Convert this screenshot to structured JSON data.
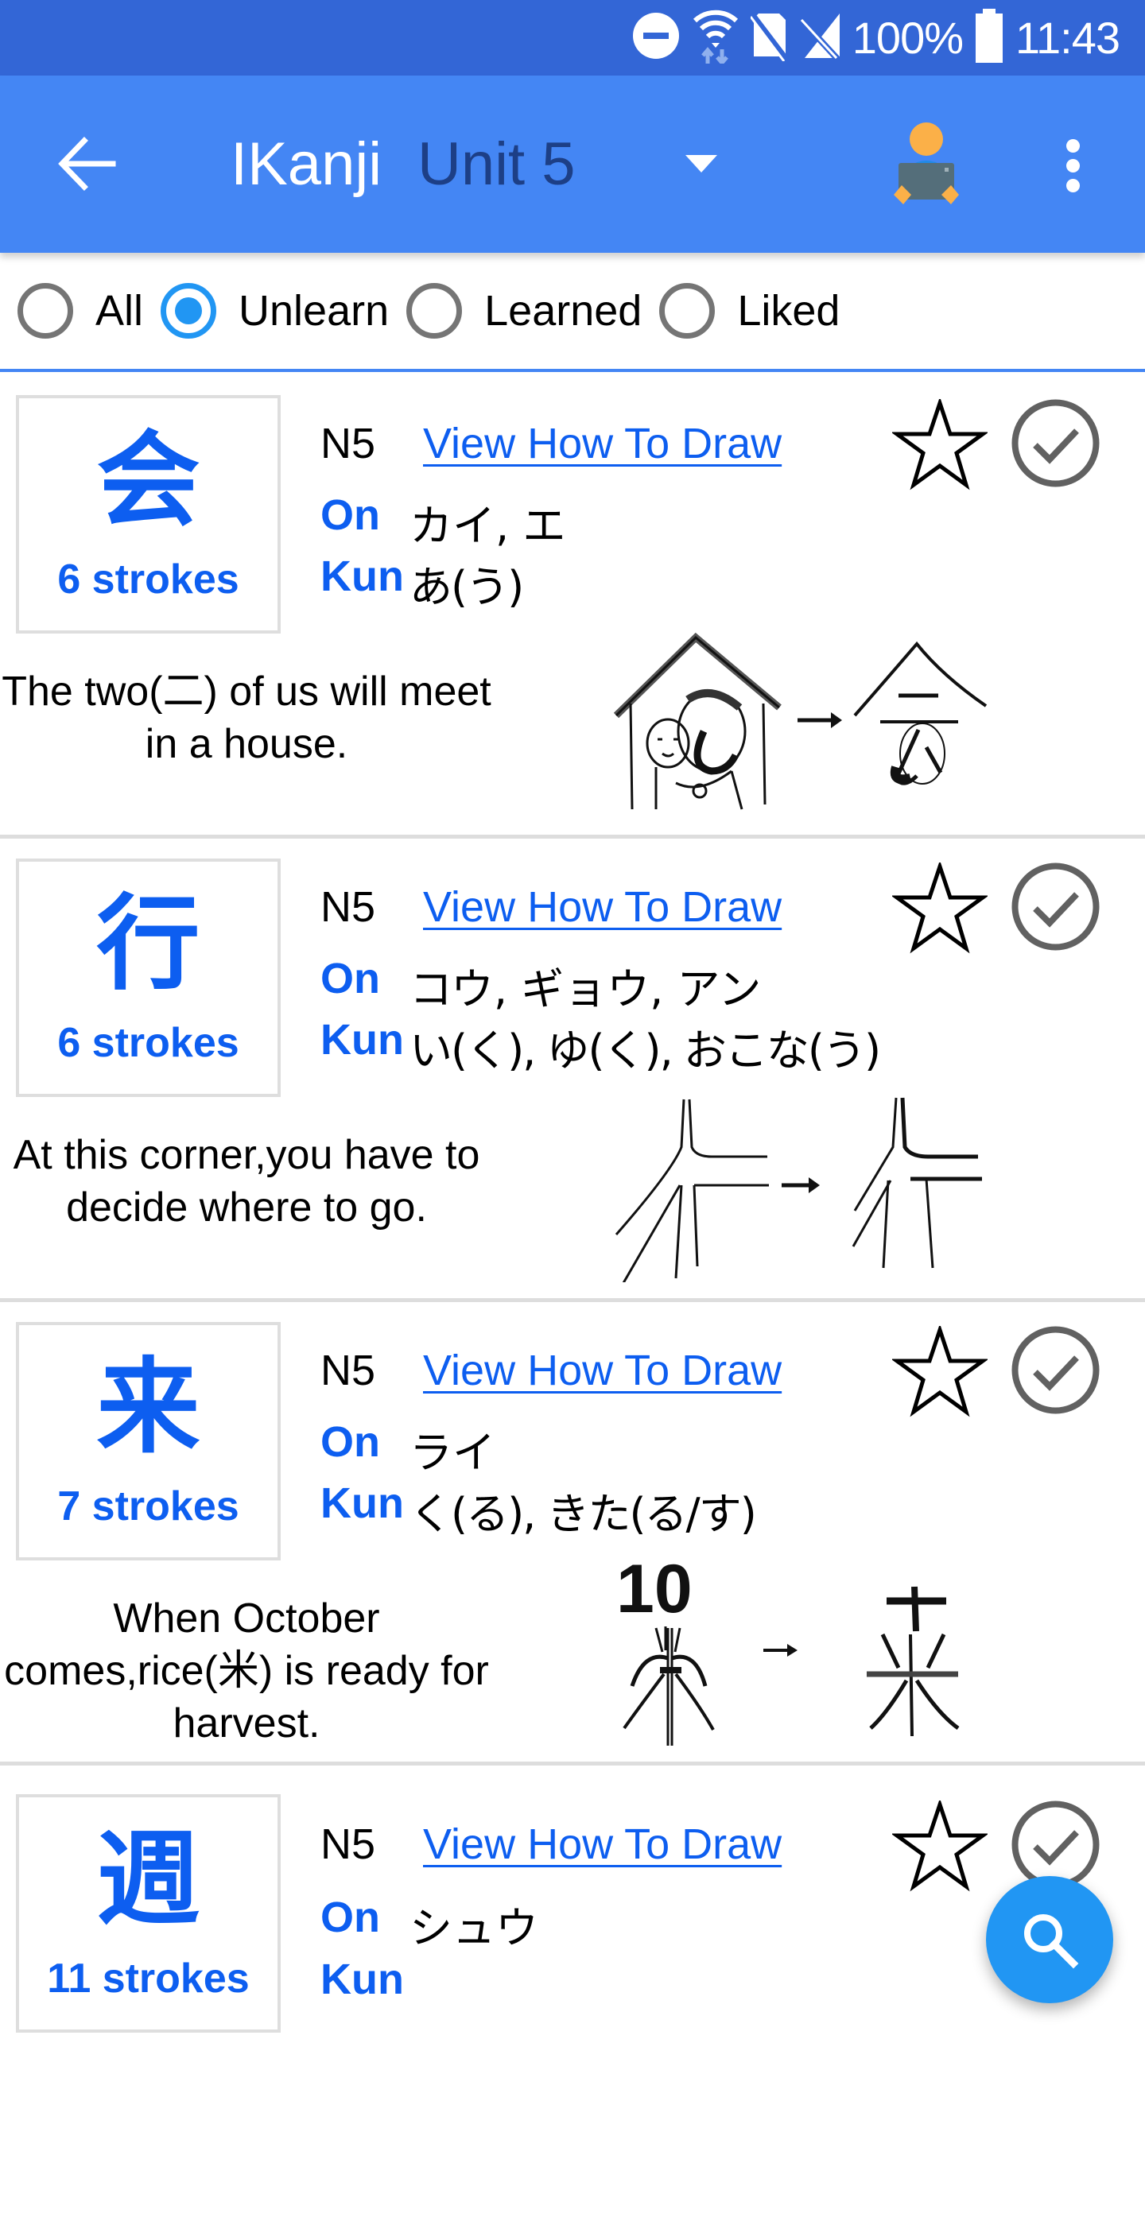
{
  "status_bar": {
    "battery_percent": "100%",
    "time": "11:43",
    "icons": [
      "do-not-disturb-icon",
      "wifi-data-icon",
      "no-sim-icon",
      "no-signal-icon",
      "battery-full-icon"
    ]
  },
  "toolbar": {
    "back_icon": "arrow-back-icon",
    "title": "IKanji",
    "unit_selector": "Unit 5",
    "dropdown_icon": "triangle-down-icon",
    "avatar_icon": "reading-person-icon",
    "menu_icon": "more-vertical-icon"
  },
  "filter": {
    "options": [
      {
        "label": "All",
        "checked": false
      },
      {
        "label": "Unlearn",
        "checked": true
      },
      {
        "label": "Learned",
        "checked": false
      },
      {
        "label": "Liked",
        "checked": false
      }
    ]
  },
  "cards": [
    {
      "kanji": "会",
      "strokes": "6 strokes",
      "level": "N5",
      "draw_link": "View How To Draw",
      "on_label": "On",
      "on_reading": "カイ, エ",
      "kun_label": "Kun",
      "kun_reading": "あ(う)",
      "mnemonic": "The two(二) of us will meet in a house.",
      "illustration": "house-people-to-kanji-illustration",
      "liked": false,
      "learned": false
    },
    {
      "kanji": "行",
      "strokes": "6 strokes",
      "level": "N5",
      "draw_link": "View How To Draw",
      "on_label": "On",
      "on_reading": "コウ, ギョウ, アン",
      "kun_label": "Kun",
      "kun_reading": "い(く), ゆ(く), おこな(う)",
      "mnemonic": "At this corner,you have to decide where to go.",
      "illustration": "crossroads-to-kanji-illustration",
      "liked": false,
      "learned": false
    },
    {
      "kanji": "来",
      "strokes": "7 strokes",
      "level": "N5",
      "draw_link": "View How To Draw",
      "on_label": "On",
      "on_reading": "ライ",
      "kun_label": "Kun",
      "kun_reading": "く(る), きた(る/す)",
      "mnemonic": "When October comes,rice(米) is ready for harvest.",
      "illustration": "rice-sheaf-to-kanji-illustration",
      "illustration_text": "10",
      "liked": false,
      "learned": false
    },
    {
      "kanji": "週",
      "strokes": "11 strokes",
      "level": "N5",
      "draw_link": "View How To Draw",
      "on_label": "On",
      "on_reading": "シュウ",
      "kun_label": "Kun",
      "kun_reading": "",
      "liked": false,
      "learned": false
    }
  ],
  "fab": {
    "icon": "search-icon"
  },
  "colors": {
    "status_bar": "#3366d6",
    "toolbar": "#4486f4",
    "accent": "#2196f3",
    "kanji_blue": "#0d5ef0",
    "subtitle": "#1d3f86",
    "divider": "#dddddd"
  }
}
